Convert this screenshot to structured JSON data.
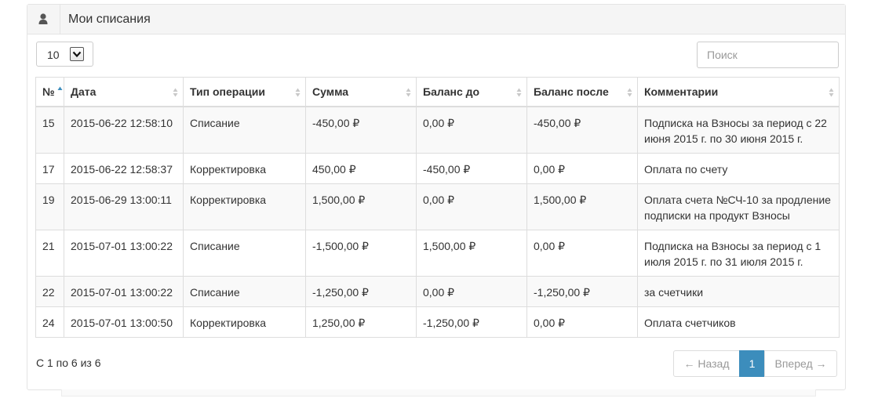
{
  "panel": {
    "title": "Мои списания",
    "icon": "user-icon"
  },
  "length": {
    "value": "10"
  },
  "search": {
    "placeholder": "Поиск",
    "value": ""
  },
  "table": {
    "columns": [
      "№",
      "Дата",
      "Тип операции",
      "Сумма",
      "Баланс до",
      "Баланс после",
      "Комментарии"
    ],
    "sorted_column": "№",
    "sort_direction": "asc",
    "rows": [
      [
        "15",
        "2015-06-22 12:58:10",
        "Списание",
        "-450,00 ₽",
        "0,00 ₽",
        "-450,00 ₽",
        "Подписка на Взносы за период с 22 июня 2015 г. по 30 июня 2015 г."
      ],
      [
        "17",
        "2015-06-22 12:58:37",
        "Корректировка",
        "450,00 ₽",
        "-450,00 ₽",
        "0,00 ₽",
        "Оплата по счету"
      ],
      [
        "19",
        "2015-06-29 13:00:11",
        "Корректировка",
        "1,500,00 ₽",
        "0,00 ₽",
        "1,500,00 ₽",
        "Оплата счета №СЧ-10 за продление подписки на продукт Взносы"
      ],
      [
        "21",
        "2015-07-01 13:00:22",
        "Списание",
        "-1,500,00 ₽",
        "1,500,00 ₽",
        "0,00 ₽",
        "Подписка на Взносы за период с 1 июля 2015 г. по 31 июля 2015 г."
      ],
      [
        "22",
        "2015-07-01 13:00:22",
        "Списание",
        "-1,250,00 ₽",
        "0,00 ₽",
        "-1,250,00 ₽",
        "за счетчики"
      ],
      [
        "24",
        "2015-07-01 13:00:50",
        "Корректировка",
        "1,250,00 ₽",
        "-1,250,00 ₽",
        "0,00 ₽",
        "Оплата счетчиков"
      ]
    ]
  },
  "footer": {
    "info": "С 1 по 6 из 6",
    "prev": "← Назад",
    "page": "1",
    "next": "Вперед →"
  },
  "colors": {
    "accent": "#3c8dbc",
    "stripe": "#f9f9f9",
    "border": "#dddddd"
  }
}
